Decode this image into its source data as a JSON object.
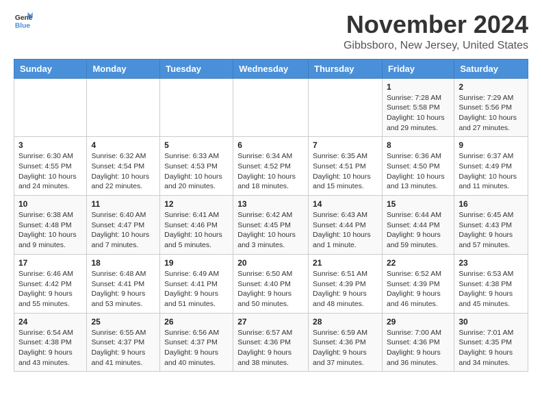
{
  "header": {
    "logo_general": "General",
    "logo_blue": "Blue",
    "month": "November 2024",
    "location": "Gibbsboro, New Jersey, United States"
  },
  "days_of_week": [
    "Sunday",
    "Monday",
    "Tuesday",
    "Wednesday",
    "Thursday",
    "Friday",
    "Saturday"
  ],
  "weeks": [
    [
      {
        "day": "",
        "info": ""
      },
      {
        "day": "",
        "info": ""
      },
      {
        "day": "",
        "info": ""
      },
      {
        "day": "",
        "info": ""
      },
      {
        "day": "",
        "info": ""
      },
      {
        "day": "1",
        "info": "Sunrise: 7:28 AM\nSunset: 5:58 PM\nDaylight: 10 hours and 29 minutes."
      },
      {
        "day": "2",
        "info": "Sunrise: 7:29 AM\nSunset: 5:56 PM\nDaylight: 10 hours and 27 minutes."
      }
    ],
    [
      {
        "day": "3",
        "info": "Sunrise: 6:30 AM\nSunset: 4:55 PM\nDaylight: 10 hours and 24 minutes."
      },
      {
        "day": "4",
        "info": "Sunrise: 6:32 AM\nSunset: 4:54 PM\nDaylight: 10 hours and 22 minutes."
      },
      {
        "day": "5",
        "info": "Sunrise: 6:33 AM\nSunset: 4:53 PM\nDaylight: 10 hours and 20 minutes."
      },
      {
        "day": "6",
        "info": "Sunrise: 6:34 AM\nSunset: 4:52 PM\nDaylight: 10 hours and 18 minutes."
      },
      {
        "day": "7",
        "info": "Sunrise: 6:35 AM\nSunset: 4:51 PM\nDaylight: 10 hours and 15 minutes."
      },
      {
        "day": "8",
        "info": "Sunrise: 6:36 AM\nSunset: 4:50 PM\nDaylight: 10 hours and 13 minutes."
      },
      {
        "day": "9",
        "info": "Sunrise: 6:37 AM\nSunset: 4:49 PM\nDaylight: 10 hours and 11 minutes."
      }
    ],
    [
      {
        "day": "10",
        "info": "Sunrise: 6:38 AM\nSunset: 4:48 PM\nDaylight: 10 hours and 9 minutes."
      },
      {
        "day": "11",
        "info": "Sunrise: 6:40 AM\nSunset: 4:47 PM\nDaylight: 10 hours and 7 minutes."
      },
      {
        "day": "12",
        "info": "Sunrise: 6:41 AM\nSunset: 4:46 PM\nDaylight: 10 hours and 5 minutes."
      },
      {
        "day": "13",
        "info": "Sunrise: 6:42 AM\nSunset: 4:45 PM\nDaylight: 10 hours and 3 minutes."
      },
      {
        "day": "14",
        "info": "Sunrise: 6:43 AM\nSunset: 4:44 PM\nDaylight: 10 hours and 1 minute."
      },
      {
        "day": "15",
        "info": "Sunrise: 6:44 AM\nSunset: 4:44 PM\nDaylight: 9 hours and 59 minutes."
      },
      {
        "day": "16",
        "info": "Sunrise: 6:45 AM\nSunset: 4:43 PM\nDaylight: 9 hours and 57 minutes."
      }
    ],
    [
      {
        "day": "17",
        "info": "Sunrise: 6:46 AM\nSunset: 4:42 PM\nDaylight: 9 hours and 55 minutes."
      },
      {
        "day": "18",
        "info": "Sunrise: 6:48 AM\nSunset: 4:41 PM\nDaylight: 9 hours and 53 minutes."
      },
      {
        "day": "19",
        "info": "Sunrise: 6:49 AM\nSunset: 4:41 PM\nDaylight: 9 hours and 51 minutes."
      },
      {
        "day": "20",
        "info": "Sunrise: 6:50 AM\nSunset: 4:40 PM\nDaylight: 9 hours and 50 minutes."
      },
      {
        "day": "21",
        "info": "Sunrise: 6:51 AM\nSunset: 4:39 PM\nDaylight: 9 hours and 48 minutes."
      },
      {
        "day": "22",
        "info": "Sunrise: 6:52 AM\nSunset: 4:39 PM\nDaylight: 9 hours and 46 minutes."
      },
      {
        "day": "23",
        "info": "Sunrise: 6:53 AM\nSunset: 4:38 PM\nDaylight: 9 hours and 45 minutes."
      }
    ],
    [
      {
        "day": "24",
        "info": "Sunrise: 6:54 AM\nSunset: 4:38 PM\nDaylight: 9 hours and 43 minutes."
      },
      {
        "day": "25",
        "info": "Sunrise: 6:55 AM\nSunset: 4:37 PM\nDaylight: 9 hours and 41 minutes."
      },
      {
        "day": "26",
        "info": "Sunrise: 6:56 AM\nSunset: 4:37 PM\nDaylight: 9 hours and 40 minutes."
      },
      {
        "day": "27",
        "info": "Sunrise: 6:57 AM\nSunset: 4:36 PM\nDaylight: 9 hours and 38 minutes."
      },
      {
        "day": "28",
        "info": "Sunrise: 6:59 AM\nSunset: 4:36 PM\nDaylight: 9 hours and 37 minutes."
      },
      {
        "day": "29",
        "info": "Sunrise: 7:00 AM\nSunset: 4:36 PM\nDaylight: 9 hours and 36 minutes."
      },
      {
        "day": "30",
        "info": "Sunrise: 7:01 AM\nSunset: 4:35 PM\nDaylight: 9 hours and 34 minutes."
      }
    ]
  ]
}
